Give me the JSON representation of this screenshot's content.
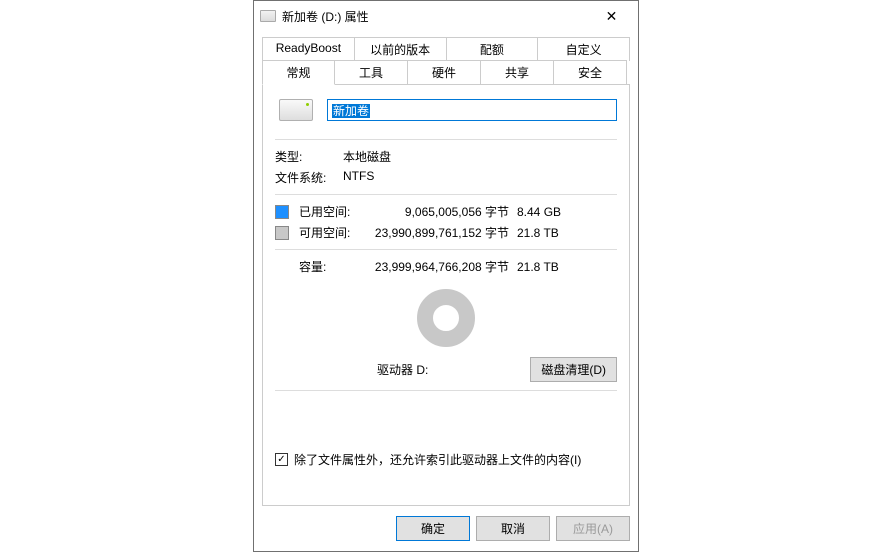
{
  "title": "新加卷 (D:) 属性",
  "tabs": {
    "top": [
      "ReadyBoost",
      "以前的版本",
      "配额",
      "自定义"
    ],
    "bottom": [
      "常规",
      "工具",
      "硬件",
      "共享",
      "安全"
    ],
    "active": "常规"
  },
  "volume_name": "新加卷",
  "type": {
    "label": "类型:",
    "value": "本地磁盘"
  },
  "filesystem": {
    "label": "文件系统:",
    "value": "NTFS"
  },
  "used": {
    "label": "已用空间:",
    "bytes": "9,065,005,056 字节",
    "hr": "8.44 GB"
  },
  "free": {
    "label": "可用空间:",
    "bytes": "23,990,899,761,152 字节",
    "hr": "21.8 TB"
  },
  "capacity": {
    "label": "容量:",
    "bytes": "23,999,964,766,208 字节",
    "hr": "21.8 TB"
  },
  "drive_label": "驱动器 D:",
  "disk_cleanup": "磁盘清理(D)",
  "index_checkbox": "除了文件属性外，还允许索引此驱动器上文件的内容(I)",
  "buttons": {
    "ok": "确定",
    "cancel": "取消",
    "apply": "应用(A)"
  },
  "chart_data": {
    "type": "pie",
    "title": "驱动器 D:",
    "series": [
      {
        "name": "已用空间",
        "value": 9065005056,
        "color": "#1e90ff"
      },
      {
        "name": "可用空间",
        "value": 23990899761152,
        "color": "#c8c8c8"
      }
    ]
  }
}
